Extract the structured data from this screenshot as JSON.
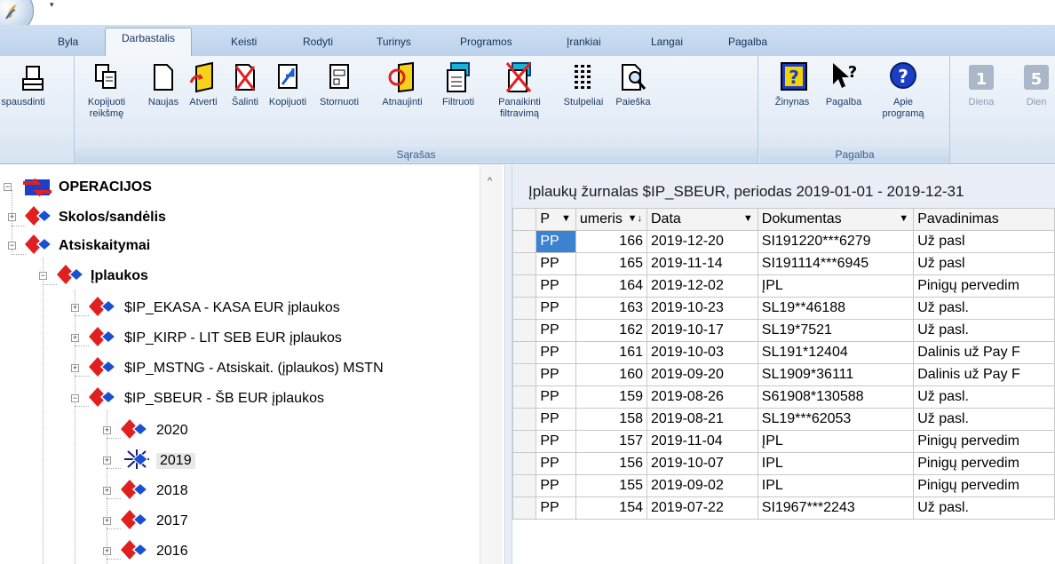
{
  "menu": {
    "tabs": [
      "Byla",
      "Darbastalis",
      "Keisti",
      "Rodyti",
      "Turinys",
      "Programos",
      "Įrankiai",
      "Langai",
      "Pagalba"
    ],
    "active_tab": "Darbastalis"
  },
  "ribbon": {
    "print_partial": "spausdinti",
    "list_group": {
      "label": "Sąrašas",
      "buttons": [
        {
          "label": "Kopijuoti reikšmę",
          "icon": "copy-value-icon"
        },
        {
          "label": "Naujas",
          "icon": "new-document-icon"
        },
        {
          "label": "Atverti",
          "icon": "open-folder-icon"
        },
        {
          "label": "Šalinti",
          "icon": "delete-icon"
        },
        {
          "label": "Kopijuoti",
          "icon": "copy-icon"
        },
        {
          "label": "Stornuoti",
          "icon": "storno-icon"
        },
        {
          "label": "Atnaujinti",
          "icon": "refresh-icon"
        },
        {
          "label": "Filtruoti",
          "icon": "filter-icon"
        },
        {
          "label": "Panaikinti filtravimą",
          "icon": "remove-filter-icon"
        },
        {
          "label": "Stulpeliai",
          "icon": "columns-icon"
        },
        {
          "label": "Paieška",
          "icon": "search-icon"
        }
      ]
    },
    "help_group": {
      "label": "Pagalba",
      "buttons": [
        {
          "label": "Žinynas",
          "icon": "help-book-icon"
        },
        {
          "label": "Pagalba",
          "icon": "help-pointer-icon"
        },
        {
          "label": "Apie programą",
          "icon": "about-icon"
        }
      ]
    },
    "calendar_group": {
      "buttons": [
        {
          "label": "Diena",
          "number": "1"
        },
        {
          "label": "Dien",
          "number": "5"
        }
      ]
    }
  },
  "tree": {
    "root": "OPERACIJOS",
    "nodes": [
      {
        "label": "Skolos/sandėlis"
      },
      {
        "label": "Atsiskaitymai"
      },
      {
        "label": "Įplaukos"
      },
      {
        "label": "$IP_EKASA - KASA EUR įplaukos"
      },
      {
        "label": "$IP_KIRP - LIT SEB EUR įplaukos"
      },
      {
        "label": "$IP_MSTNG - Atsiskait. (įplaukos) MSTN"
      },
      {
        "label": "$IP_SBEUR - ŠB EUR įplaukos"
      },
      {
        "label": "2020"
      },
      {
        "label": "2019"
      },
      {
        "label": "2018"
      },
      {
        "label": "2017"
      },
      {
        "label": "2016"
      }
    ]
  },
  "grid": {
    "title": "Įplaukų žurnalas $IP_SBEUR, periodas 2019-01-01 - 2019-12-31",
    "columns": [
      "P",
      "umeris",
      "Data",
      "Dokumentas",
      "Pavadinimas"
    ],
    "rows": [
      [
        "PP",
        "166",
        "2019-12-20",
        "SI191220***6279",
        "Už pasl"
      ],
      [
        "PP",
        "165",
        "2019-11-14",
        "SI191114***6945",
        "Už pasl"
      ],
      [
        "PP",
        "164",
        "2019-12-02",
        "ĮPL",
        "Pinigų pervedim"
      ],
      [
        "PP",
        "163",
        "2019-10-23",
        "SL19**46188",
        "Už pasl."
      ],
      [
        "PP",
        "162",
        "2019-10-17",
        "SL19*7521",
        "Už pasl."
      ],
      [
        "PP",
        "161",
        "2019-10-03",
        "SL191*12404",
        "Dalinis už Pay F"
      ],
      [
        "PP",
        "160",
        "2019-09-20",
        "SL1909*36111",
        "Dalinis už Pay F"
      ],
      [
        "PP",
        "159",
        "2019-08-26",
        "S61908*130588",
        "Už pasl."
      ],
      [
        "PP",
        "158",
        "2019-08-21",
        "SL19***62053",
        "Už pasl."
      ],
      [
        "PP",
        "157",
        "2019-11-04",
        "ĮPL",
        "Pinigų pervedim"
      ],
      [
        "PP",
        "156",
        "2019-10-07",
        "IPL",
        "Pinigų pervedim"
      ],
      [
        "PP",
        "155",
        "2019-09-02",
        "IPL",
        "Pinigų pervedim"
      ],
      [
        "PP",
        "154",
        "2019-07-22",
        "SI1967***2243",
        "Už pasl."
      ]
    ]
  }
}
